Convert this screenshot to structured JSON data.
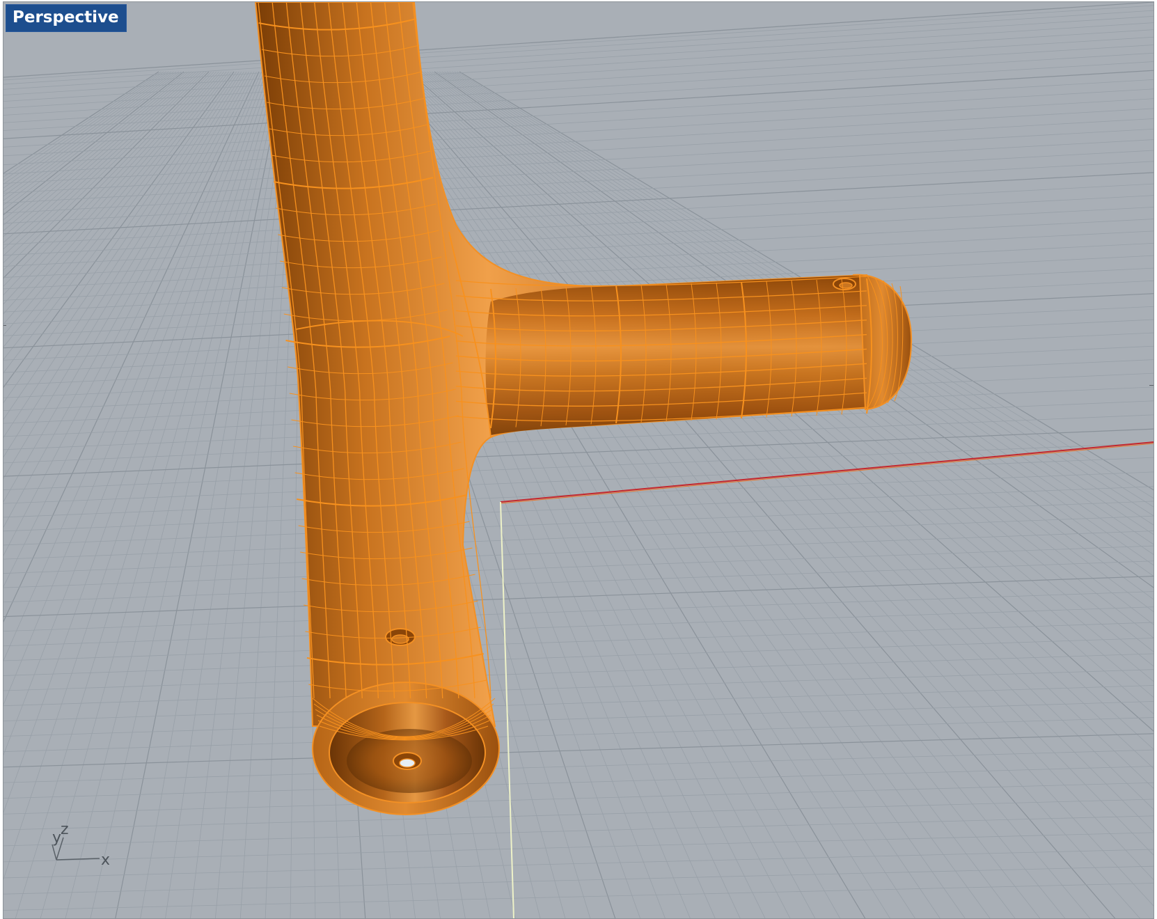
{
  "viewport": {
    "title": "Perspective",
    "background": "#a9afb6",
    "grid_color": "#98a0a8",
    "grid_major_color": "#8a929a"
  },
  "model": {
    "selection_color": "#f7911e",
    "shade_dark": "#6b3608",
    "shade_light": "#f3a24b"
  },
  "axes": {
    "x_label": "x",
    "y_label": "y",
    "z_label": "z",
    "x_axis_color": "#c4282d",
    "y_axis_color": "#dfe9a5"
  }
}
